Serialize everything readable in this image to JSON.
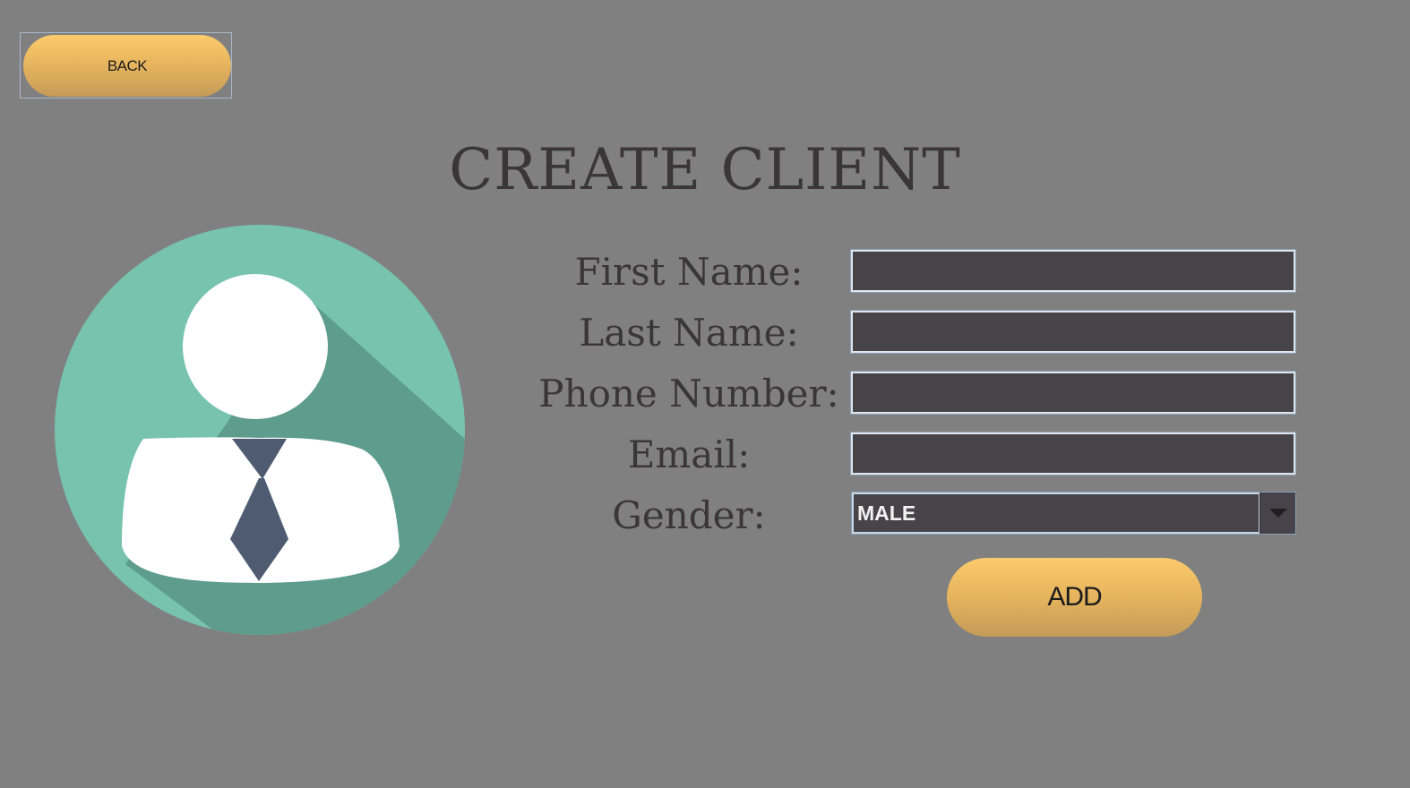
{
  "header": {
    "back_label": "BACK",
    "title": "CREATE CLIENT"
  },
  "form": {
    "first_name_label": "First Name:",
    "first_name_value": "",
    "last_name_label": "Last Name:",
    "last_name_value": "",
    "phone_label": "Phone Number:",
    "phone_value": "",
    "email_label": "Email:",
    "email_value": "",
    "gender_label": "Gender:",
    "gender_selected": "MALE",
    "add_label": "ADD"
  },
  "icons": {
    "avatar": "client-avatar-icon",
    "dropdown": "chevron-down-icon"
  },
  "colors": {
    "background": "#808080",
    "button_gold": "#e8b65e",
    "avatar_teal": "#77c3ae",
    "avatar_shadow": "#5e9c8d",
    "tie": "#4e5b71",
    "field_bg": "#464448",
    "text_dark": "#3a3637"
  }
}
